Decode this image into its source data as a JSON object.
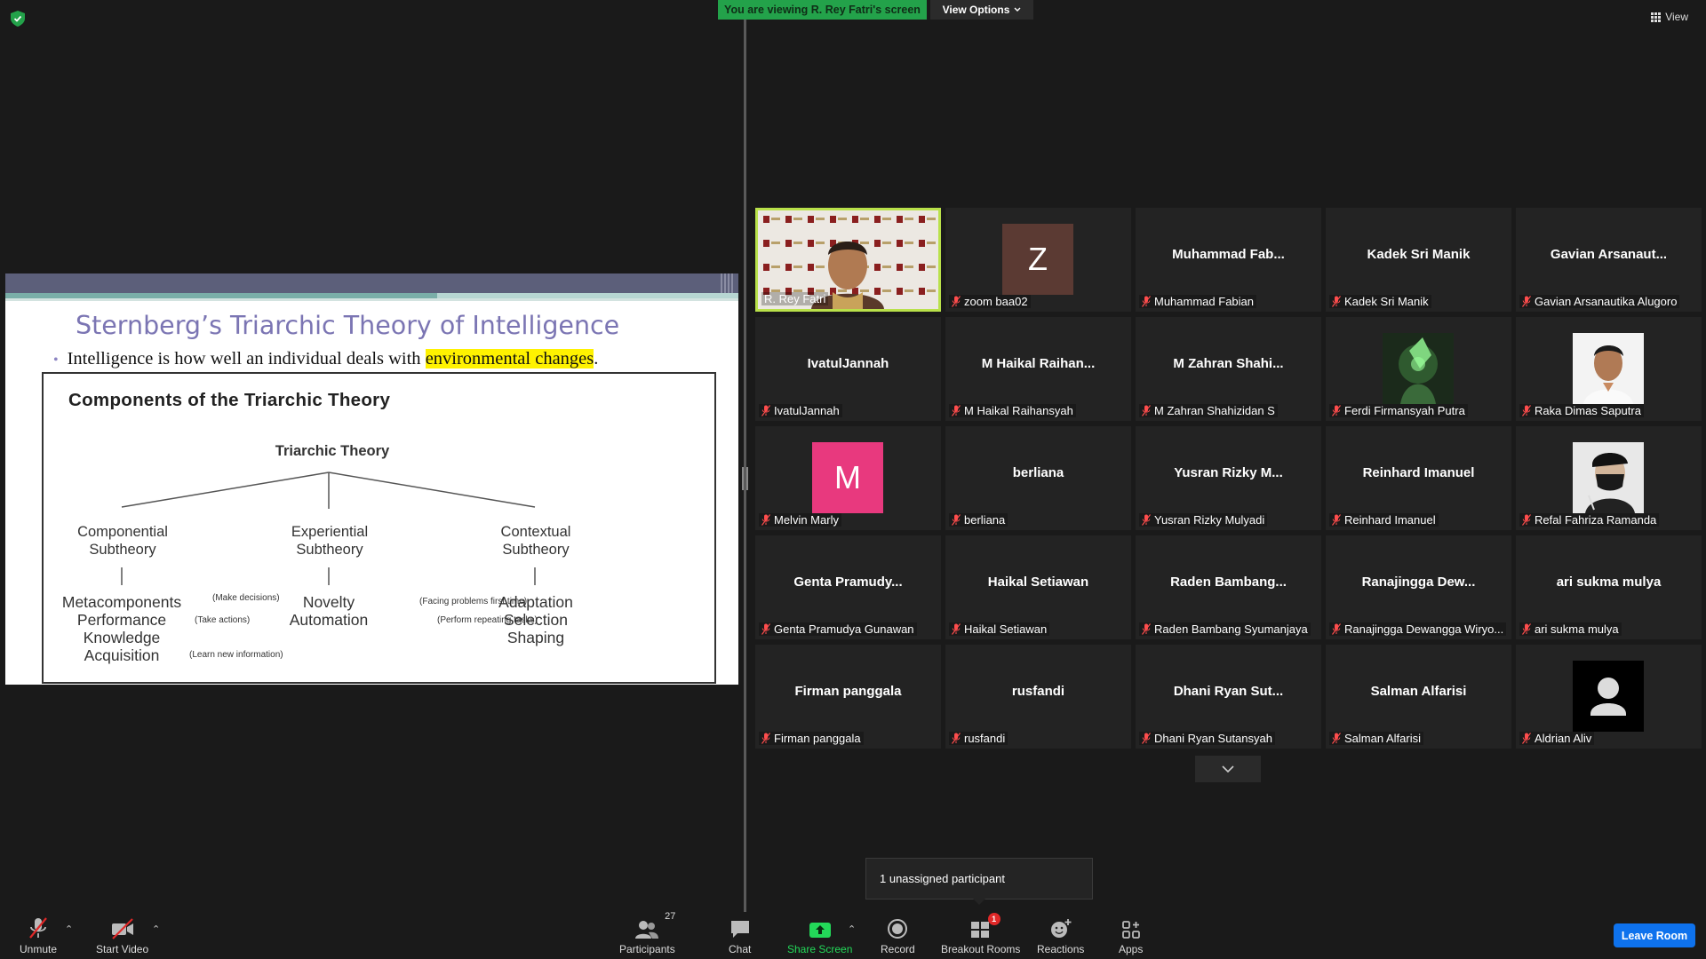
{
  "top": {
    "viewing_banner": "You are viewing R. Rey Fatri's screen",
    "view_options": "View Options",
    "view": "View"
  },
  "slide": {
    "title": "Sternberg’s Triarchic Theory of Intelligence",
    "bullet_text": "Intelligence is how well an individual deals with ",
    "bullet_highlight": "environmental changes",
    "bullet_end": ".",
    "figure": {
      "title": "Components of the Triarchic Theory",
      "root": "Triarchic Theory",
      "sub1_line1": "Componential",
      "sub1_line2": "Subtheory",
      "sub2_line1": "Experiential",
      "sub2_line2": "Subtheory",
      "sub3_line1": "Contextual",
      "sub3_line2": "Subtheory",
      "comp_items": [
        "Metacomponents",
        "Performance",
        "Knowledge",
        "Acquisition"
      ],
      "comp_notes": [
        "(Make decisions)",
        "(Take actions)",
        "(Learn new information)"
      ],
      "exp_items": [
        "Novelty",
        "Automation"
      ],
      "exp_notes": [
        "(Facing problems first time)",
        "(Perform repeating tasks)"
      ],
      "ctx_items": [
        "Adaptation",
        "Selection",
        "Shaping"
      ]
    }
  },
  "participants": [
    {
      "big": "",
      "label": "R. Rey Fatri",
      "muted": false,
      "kind": "video"
    },
    {
      "big": "",
      "label": "zoom baa02",
      "muted": true,
      "kind": "letter",
      "letter": "Z",
      "color": "#5b3a33"
    },
    {
      "big": "Muhammad  Fab...",
      "label": "Muhammad Fabian",
      "muted": true,
      "kind": "name"
    },
    {
      "big": "Kadek Sri Manik",
      "label": "Kadek Sri Manik",
      "muted": true,
      "kind": "name"
    },
    {
      "big": "Gavian  Arsanaut...",
      "label": "Gavian Arsanautika Alugoro",
      "muted": true,
      "kind": "name"
    },
    {
      "big": "IvatulJannah",
      "label": "IvatulJannah",
      "muted": true,
      "kind": "name"
    },
    {
      "big": "M  Haikal  Raihan...",
      "label": "M Haikal Raihansyah",
      "muted": true,
      "kind": "name"
    },
    {
      "big": "M  Zahran  Shahi...",
      "label": "M Zahran Shahizidan S",
      "muted": true,
      "kind": "name"
    },
    {
      "big": "",
      "label": "Ferdi Firmansyah Putra",
      "muted": true,
      "kind": "photo-green"
    },
    {
      "big": "",
      "label": "Raka Dimas Saputra",
      "muted": true,
      "kind": "photo-person"
    },
    {
      "big": "",
      "label": "Melvin Marly",
      "muted": true,
      "kind": "letter",
      "letter": "M",
      "color": "#e8397e"
    },
    {
      "big": "berliana",
      "label": "berliana",
      "muted": true,
      "kind": "name"
    },
    {
      "big": "Yusran  Rizky  M...",
      "label": "Yusran Rizky Mulyadi",
      "muted": true,
      "kind": "name"
    },
    {
      "big": "Reinhard Imanuel",
      "label": "Reinhard Imanuel",
      "muted": true,
      "kind": "name"
    },
    {
      "big": "",
      "label": "Refal Fahriza Ramanda",
      "muted": true,
      "kind": "photo-mask"
    },
    {
      "big": "Genta  Pramudy...",
      "label": "Genta Pramudya Gunawan",
      "muted": true,
      "kind": "name"
    },
    {
      "big": "Haikal Setiawan",
      "label": "Haikal Setiawan",
      "muted": true,
      "kind": "name"
    },
    {
      "big": "Raden  Bambang...",
      "label": "Raden Bambang Syumanjaya",
      "muted": true,
      "kind": "name"
    },
    {
      "big": "Ranajingga  Dew...",
      "label": "Ranajingga Dewangga Wiryo...",
      "muted": true,
      "kind": "name"
    },
    {
      "big": "ari sukma mulya",
      "label": "ari sukma mulya",
      "muted": true,
      "kind": "name"
    },
    {
      "big": "Firman panggala",
      "label": "Firman panggala",
      "muted": true,
      "kind": "name"
    },
    {
      "big": "rusfandi",
      "label": "rusfandi",
      "muted": true,
      "kind": "name"
    },
    {
      "big": "Dhani  Ryan  Sut...",
      "label": "Dhani Ryan Sutansyah",
      "muted": true,
      "kind": "name"
    },
    {
      "big": "Salman Alfarisi",
      "label": "Salman Alfarisi",
      "muted": true,
      "kind": "name"
    },
    {
      "big": "",
      "label": "Aldrian Aliv",
      "muted": true,
      "kind": "default-avatar"
    }
  ],
  "tooltip": "1 unassigned participant",
  "toolbar": {
    "unmute": "Unmute",
    "start_video": "Start Video",
    "participants": "Participants",
    "participants_count": "27",
    "chat": "Chat",
    "share_screen": "Share Screen",
    "record": "Record",
    "breakout_rooms": "Breakout Rooms",
    "breakout_badge": "1",
    "reactions": "Reactions",
    "apps": "Apps",
    "leave": "Leave Room"
  },
  "colors": {
    "banner_green": "#23a24a",
    "share_green": "#23d959",
    "leave_blue": "#0e72ed",
    "active_speaker": "#b9e14a",
    "mute_red": "#e02828"
  }
}
